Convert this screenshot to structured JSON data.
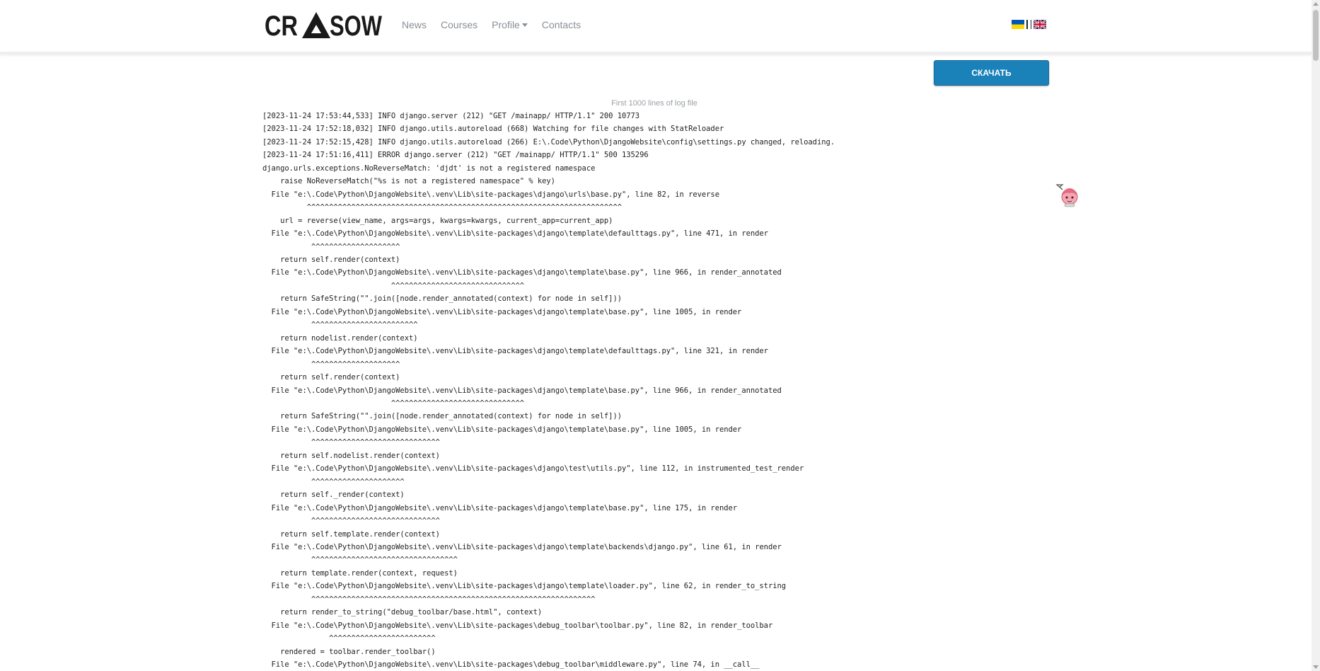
{
  "brand": {
    "logo_text": "CRASOW"
  },
  "nav": {
    "items": [
      "News",
      "Courses",
      "Profile",
      "Contacts"
    ]
  },
  "languages": [
    {
      "name": "Ukrainian",
      "icon": "ukraine-flag-icon"
    },
    {
      "name": "English",
      "icon": "uk-flag-icon"
    }
  ],
  "download": {
    "label": "СКАЧАТЬ"
  },
  "log": {
    "caption": "First 1000 lines of log file",
    "lines": [
      "[2023-11-24 17:53:44,533] INFO django.server (212) \"GET /mainapp/ HTTP/1.1\" 200 10773",
      "[2023-11-24 17:52:18,032] INFO django.utils.autoreload (668) Watching for file changes with StatReloader",
      "[2023-11-24 17:52:15,428] INFO django.utils.autoreload (266) E:\\.Code\\Python\\DjangoWebsite\\config\\settings.py changed, reloading.",
      "[2023-11-24 17:51:16,411] ERROR django.server (212) \"GET /mainapp/ HTTP/1.1\" 500 135296",
      "django.urls.exceptions.NoReverseMatch: 'djdt' is not a registered namespace",
      "    raise NoReverseMatch(\"%s is not a registered namespace\" % key)",
      "  File \"e:\\.Code\\Python\\DjangoWebsite\\.venv\\Lib\\site-packages\\django\\urls\\base.py\", line 82, in reverse",
      "          ^^^^^^^^^^^^^^^^^^^^^^^^^^^^^^^^^^^^^^^^^^^^^^^^^^^^^^^^^^^^^^^^^^^^^^^",
      "    url = reverse(view_name, args=args, kwargs=kwargs, current_app=current_app)",
      "  File \"e:\\.Code\\Python\\DjangoWebsite\\.venv\\Lib\\site-packages\\django\\template\\defaulttags.py\", line 471, in render",
      "           ^^^^^^^^^^^^^^^^^^^^",
      "    return self.render(context)",
      "  File \"e:\\.Code\\Python\\DjangoWebsite\\.venv\\Lib\\site-packages\\django\\template\\base.py\", line 966, in render_annotated",
      "                             ^^^^^^^^^^^^^^^^^^^^^^^^^^^^^^",
      "    return SafeString(\"\".join([node.render_annotated(context) for node in self]))",
      "  File \"e:\\.Code\\Python\\DjangoWebsite\\.venv\\Lib\\site-packages\\django\\template\\base.py\", line 1005, in render",
      "           ^^^^^^^^^^^^^^^^^^^^^^^^",
      "    return nodelist.render(context)",
      "  File \"e:\\.Code\\Python\\DjangoWebsite\\.venv\\Lib\\site-packages\\django\\template\\defaulttags.py\", line 321, in render",
      "           ^^^^^^^^^^^^^^^^^^^^",
      "    return self.render(context)",
      "  File \"e:\\.Code\\Python\\DjangoWebsite\\.venv\\Lib\\site-packages\\django\\template\\base.py\", line 966, in render_annotated",
      "                             ^^^^^^^^^^^^^^^^^^^^^^^^^^^^^^",
      "    return SafeString(\"\".join([node.render_annotated(context) for node in self]))",
      "  File \"e:\\.Code\\Python\\DjangoWebsite\\.venv\\Lib\\site-packages\\django\\template\\base.py\", line 1005, in render",
      "           ^^^^^^^^^^^^^^^^^^^^^^^^^^^^^",
      "    return self.nodelist.render(context)",
      "  File \"e:\\.Code\\Python\\DjangoWebsite\\.venv\\Lib\\site-packages\\django\\test\\utils.py\", line 112, in instrumented_test_render",
      "           ^^^^^^^^^^^^^^^^^^^^^",
      "    return self._render(context)",
      "  File \"e:\\.Code\\Python\\DjangoWebsite\\.venv\\Lib\\site-packages\\django\\template\\base.py\", line 175, in render",
      "           ^^^^^^^^^^^^^^^^^^^^^^^^^^^^^",
      "    return self.template.render(context)",
      "  File \"e:\\.Code\\Python\\DjangoWebsite\\.venv\\Lib\\site-packages\\django\\template\\backends\\django.py\", line 61, in render",
      "           ^^^^^^^^^^^^^^^^^^^^^^^^^^^^^^^^^",
      "    return template.render(context, request)",
      "  File \"e:\\.Code\\Python\\DjangoWebsite\\.venv\\Lib\\site-packages\\django\\template\\loader.py\", line 62, in render_to_string",
      "           ^^^^^^^^^^^^^^^^^^^^^^^^^^^^^^^^^^^^^^^^^^^^^^^^^^^^^^^^^^^^^^^^",
      "    return render_to_string(\"debug_toolbar/base.html\", context)",
      "  File \"e:\\.Code\\Python\\DjangoWebsite\\.venv\\Lib\\site-packages\\debug_toolbar\\toolbar.py\", line 82, in render_toolbar",
      "               ^^^^^^^^^^^^^^^^^^^^^^^^",
      "    rendered = toolbar.render_toolbar()",
      "  File \"e:\\.Code\\Python\\DjangoWebsite\\.venv\\Lib\\site-packages\\debug_toolbar\\middleware.py\", line 74, in __call__"
    ]
  },
  "colors": {
    "accent": "#1b82b9",
    "nav_text": "#8a8f95",
    "log_text": "#222222"
  }
}
